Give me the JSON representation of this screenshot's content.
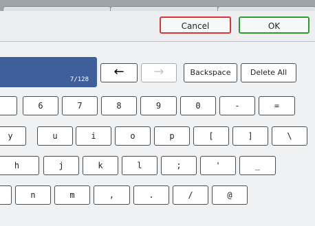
{
  "dialog": {
    "cancel_label": "Cancel",
    "ok_label": "OK"
  },
  "input": {
    "counter": "7/128"
  },
  "function_keys": {
    "left_arrow": "←",
    "right_arrow": "→",
    "backspace": "Backspace",
    "delete_all": "Delete All"
  },
  "keyboard": {
    "row1": [
      "",
      "6",
      "7",
      "8",
      "9",
      "0",
      "-",
      "="
    ],
    "row2": [
      "y",
      "u",
      "i",
      "o",
      "p",
      "[",
      "]",
      "\\"
    ],
    "row3": [
      "h",
      "j",
      "k",
      "l",
      ";",
      "'",
      "_"
    ],
    "row4": [
      "",
      "n",
      "m",
      ",",
      ".",
      "/",
      "@"
    ]
  },
  "colors": {
    "cancel_border": "#d9323a",
    "ok_border": "#2b9a2f",
    "text_field": "#3f5f9b"
  }
}
